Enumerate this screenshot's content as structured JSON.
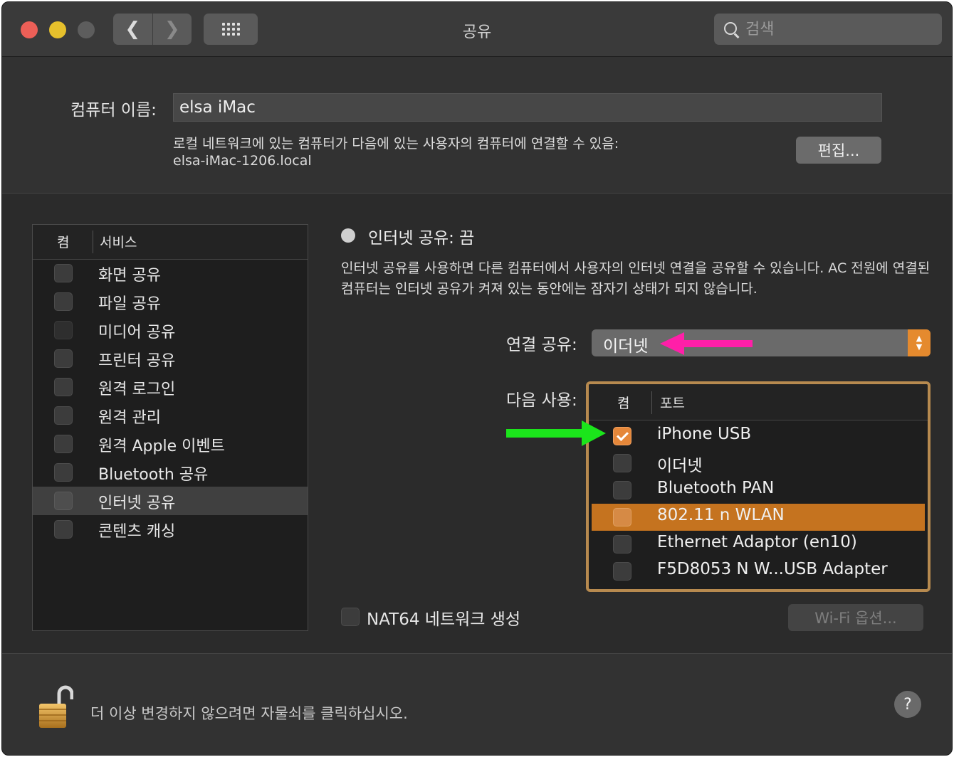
{
  "window": {
    "title": "공유",
    "search_placeholder": "검색"
  },
  "computer": {
    "name_label": "컴퓨터 이름:",
    "name_value": "elsa iMac",
    "info_line1": "로컬 네트워크에 있는 컴퓨터가 다음에 있는 사용자의 컴퓨터에 연결할 수 있음:",
    "info_line2": "elsa-iMac-1206.local",
    "edit_label": "편집..."
  },
  "services": {
    "header_on": "켬",
    "header_service": "서비스",
    "items": [
      {
        "label": "화면 공유",
        "checked": false
      },
      {
        "label": "파일 공유",
        "checked": false
      },
      {
        "label": "미디어 공유",
        "checked": false
      },
      {
        "label": "프린터 공유",
        "checked": false
      },
      {
        "label": "원격 로그인",
        "checked": false
      },
      {
        "label": "원격 관리",
        "checked": false
      },
      {
        "label": "원격 Apple 이벤트",
        "checked": false
      },
      {
        "label": "Bluetooth 공유",
        "checked": false
      },
      {
        "label": "인터넷 공유",
        "checked": false,
        "selected": true
      },
      {
        "label": "콘텐츠 캐싱",
        "checked": false
      }
    ]
  },
  "internet_sharing": {
    "status": "인터넷 공유: 끔",
    "description": "인터넷 공유를 사용하면 다른 컴퓨터에서 사용자의 인터넷 연결을 공유할 수 있습니다. AC 전원에 연결된 컴퓨터는 인터넷 공유가 켜져 있는 동안에는 잠자기 상태가 되지 않습니다.",
    "share_from_label": "연결 공유:",
    "share_from_value": "이더넷",
    "to_using_label": "다음 사용:",
    "ports_header_on": "켬",
    "ports_header_port": "포트",
    "ports": [
      {
        "label": "iPhone USB",
        "checked": true
      },
      {
        "label": "이더넷",
        "checked": false
      },
      {
        "label": "Bluetooth PAN",
        "checked": false
      },
      {
        "label": "802.11 n WLAN",
        "checked": false,
        "selected": true
      },
      {
        "label": "Ethernet Adaptor (en10)",
        "checked": false
      },
      {
        "label": "F5D8053 N W...USB Adapter",
        "checked": false
      }
    ],
    "nat64_label": "NAT64 네트워크 생성",
    "wifi_options_label": "Wi-Fi 옵션..."
  },
  "footer": {
    "lock_text": "더 이상 변경하지 않으려면 자물쇠를 클릭하십시오.",
    "help_label": "?"
  },
  "colors": {
    "accent_orange": "#e5873a",
    "selection_orange": "#c5731f",
    "annotation_pink": "#ff1fa8",
    "annotation_green": "#1be51b",
    "table_highlight_border": "#b78a4f"
  },
  "icons": [
    "back-chevron-icon",
    "forward-chevron-icon",
    "grid-icon",
    "search-icon",
    "checkmark-icon",
    "padlock-open-icon",
    "question-icon"
  ]
}
